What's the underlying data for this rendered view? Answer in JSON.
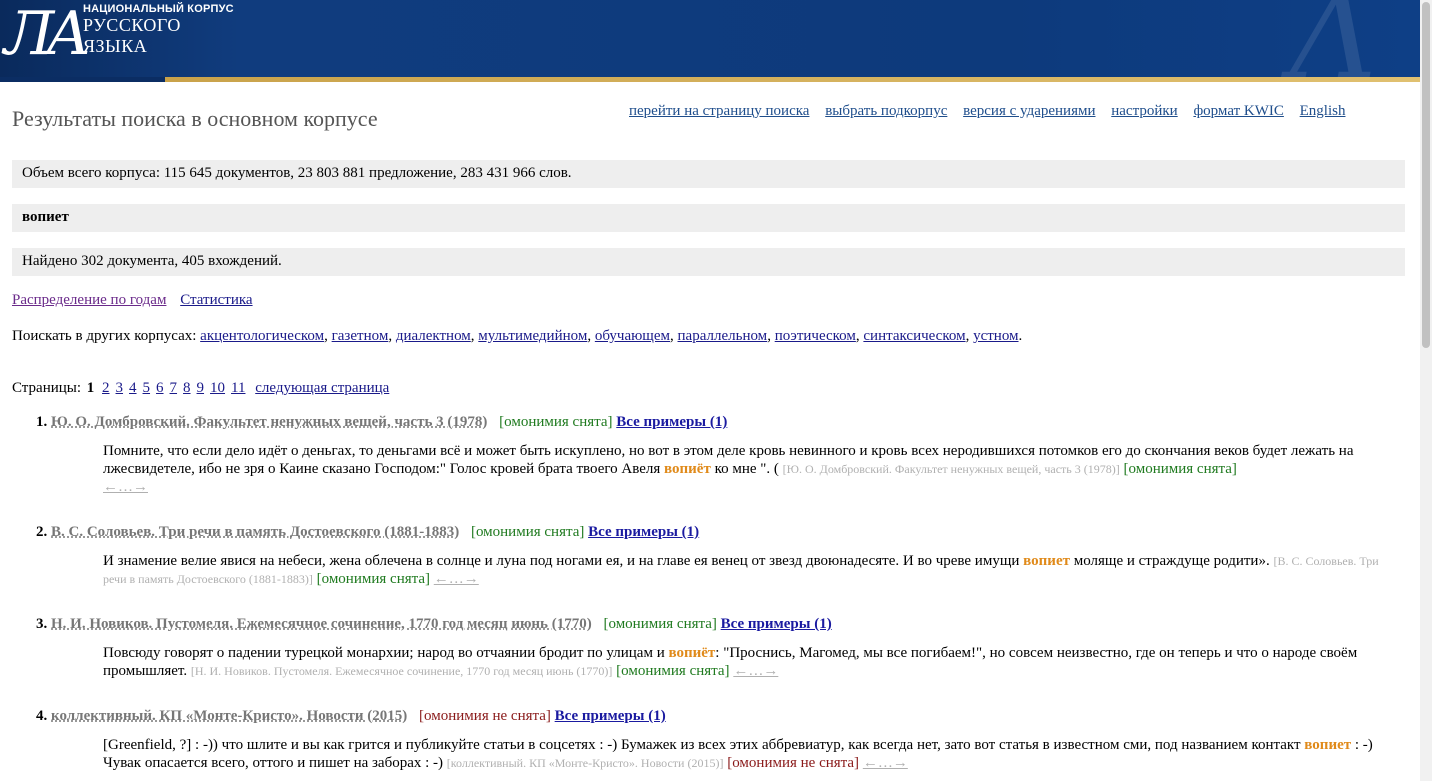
{
  "header": {
    "logo_line1": "НАЦИОНАЛЬНЫЙ КОРПУС",
    "logo_line2": "РУССКОГО",
    "logo_line3": "ЯЗЫКА",
    "logo_mark": "ЛА"
  },
  "page_title": "Результаты поиска в основном корпусе",
  "top_links": [
    "перейти на страницу поиска",
    "выбрать подкорпус",
    "версия с ударениями",
    "настройки",
    "формат KWIC",
    "English"
  ],
  "corpus_volume": "Объем всего корпуса: 115 645 документов, 23 803 881 предложение, 283 431 966 слов.",
  "query": "вопиет",
  "found": "Найдено 302 документа, 405 вхождений.",
  "stat_links": [
    "Распределение по годам",
    "Статистика"
  ],
  "other_corpora": {
    "label": "Поискать в других корпусах: ",
    "items": [
      "акцентологическом",
      "газетном",
      "диалектном",
      "мультимедийном",
      "обучающем",
      "параллельном",
      "поэтическом",
      "синтаксическом",
      "устном"
    ]
  },
  "pagination": {
    "label": "Страницы: ",
    "current": "1",
    "pages": [
      "2",
      "3",
      "4",
      "5",
      "6",
      "7",
      "8",
      "9",
      "10",
      "11"
    ],
    "next": "следующая страница"
  },
  "results": [
    {
      "num": "1.",
      "title": "Ю. О. Домбровский. Факультет ненужных вещей, часть 3 (1978)",
      "homonymy": "[омонимия снята]",
      "all_examples": "Все примеры (1)",
      "text_before": "Помните, что если дело идёт о деньгах, то деньгами всё и может быть искуплено, но вот в этом деле кровь невинного и кровь всех неродившихся потомков его до скончания веков будет лежать на лжесвидетеле, ибо не зря о Каине сказано Господом:\" Голос кровей брата твоего Авеля ",
      "keyword": "вопиёт",
      "text_after": " ко мне \". ( ",
      "source": "[Ю. О. Домбровский. Факультет ненужных вещей, часть 3 (1978)]",
      "homonymy_inline": "[омонимия снята]",
      "arrows": "←…→"
    },
    {
      "num": "2.",
      "title": "В. С. Соловьев. Три речи в память Достоевского (1881-1883)",
      "homonymy": "[омонимия снята]",
      "all_examples": "Все примеры (1)",
      "text_before": "И знамение велие явися на небеси, жена облечена в солнце и луна под ногами ея, и на главе ея венец от звезд двоюнадесяте. И во чреве имущи ",
      "keyword": "вопиет",
      "text_after": " моляще и страждуще родити». ",
      "source": "[В. С. Соловьев. Три речи в память Достоевского (1881-1883)]",
      "homonymy_inline": "[омонимия снята]",
      "arrows": "←…→"
    },
    {
      "num": "3.",
      "title": "Н. И. Новиков. Пустомеля. Ежемесячное сочинение, 1770 год месяц июнь (1770)",
      "homonymy": "[омонимия снята]",
      "all_examples": "Все примеры (1)",
      "text_before": "Повсюду говорят о падении турецкой монархии; народ во отчаянии бродит по улицам и ",
      "keyword": "вопиёт",
      "text_after": ": \"Проснись, Магомед, мы все погибаем!\", но совсем неизвестно, где он теперь и что о народе своём промышляет. ",
      "source": "[Н. И. Новиков. Пустомеля. Ежемесячное сочинение, 1770 год месяц июнь (1770)]",
      "homonymy_inline": "[омонимия снята]",
      "arrows": "←…→"
    },
    {
      "num": "4.",
      "title": "коллективный. КП «Монте-Кристо». Новости (2015)",
      "homonymy": "[омонимия не снята]",
      "all_examples": "Все примеры (1)",
      "text_before": "[Greenfield, ?] : -)) что шлите и вы как грится и публикуйте статьи в соцсетях : -) Бумажек из всех этих аббревиатур, как всегда нет, зато вот статья в известном сми, под названием контакт ",
      "keyword": "вопиет",
      "text_after": " : -) Чувак опасается всего, оттого и пишет на заборах : -) ",
      "source": "[коллективный. КП «Монте-Кристо». Новости (2015)]",
      "homonymy_inline": "[омонимия не снята]",
      "arrows": "←…→"
    }
  ]
}
